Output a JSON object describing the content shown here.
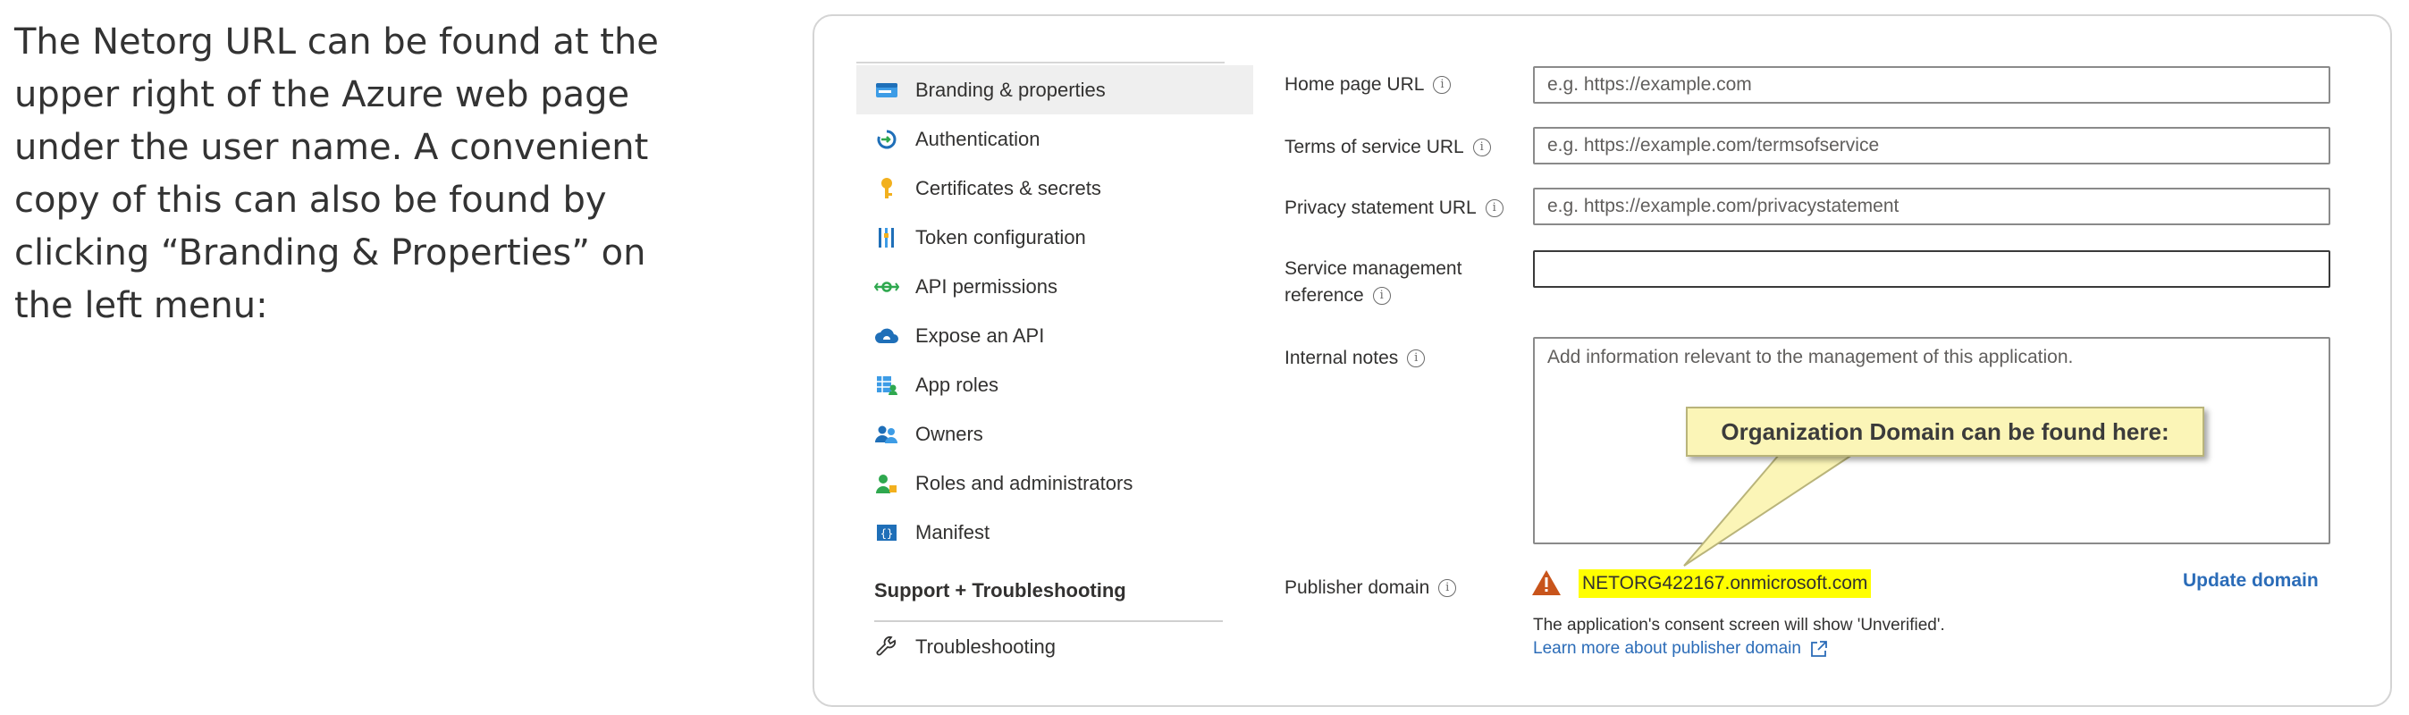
{
  "intro_text": "The Netorg URL can be found at the upper right of the Azure web page under the user name. A convenient copy of this can also be found by clicking “Branding & Properties” on the left menu:",
  "nav": {
    "items": [
      {
        "label": "Branding & properties",
        "icon": "branding-icon"
      },
      {
        "label": "Authentication",
        "icon": "authentication-icon"
      },
      {
        "label": "Certificates & secrets",
        "icon": "key-icon"
      },
      {
        "label": "Token configuration",
        "icon": "token-icon"
      },
      {
        "label": "API permissions",
        "icon": "api-permissions-icon"
      },
      {
        "label": "Expose an API",
        "icon": "cloud-icon"
      },
      {
        "label": "App roles",
        "icon": "app-roles-icon"
      },
      {
        "label": "Owners",
        "icon": "owners-icon"
      },
      {
        "label": "Roles and administrators",
        "icon": "roles-icon"
      },
      {
        "label": "Manifest",
        "icon": "manifest-icon"
      }
    ],
    "section_title": "Support + Troubleshooting",
    "troubleshooting_label": "Troubleshooting"
  },
  "form": {
    "home_page_label": "Home page URL",
    "home_page_placeholder": "e.g. https://example.com",
    "terms_label": "Terms of service URL",
    "terms_placeholder": "e.g. https://example.com/termsofservice",
    "privacy_label": "Privacy statement URL",
    "privacy_placeholder": "e.g. https://example.com/privacystatement",
    "service_mgmt_label_1": "Service management",
    "service_mgmt_label_2": "reference",
    "internal_notes_label": "Internal notes",
    "internal_notes_placeholder": "Add information relevant to the management of this application.",
    "publisher_domain_label": "Publisher domain",
    "publisher_domain_value": "NETORG422167.onmicrosoft.com",
    "update_domain": "Update domain",
    "consent_text": "The application's consent screen will show 'Unverified'.",
    "learn_more": "Learn more about publisher domain"
  },
  "callout": "Organization Domain can be found here:",
  "colors": {
    "highlight": "#ffff00",
    "link": "#2b6cb8",
    "callout_bg": "#fbf5b7",
    "warning": "#c8541b"
  }
}
